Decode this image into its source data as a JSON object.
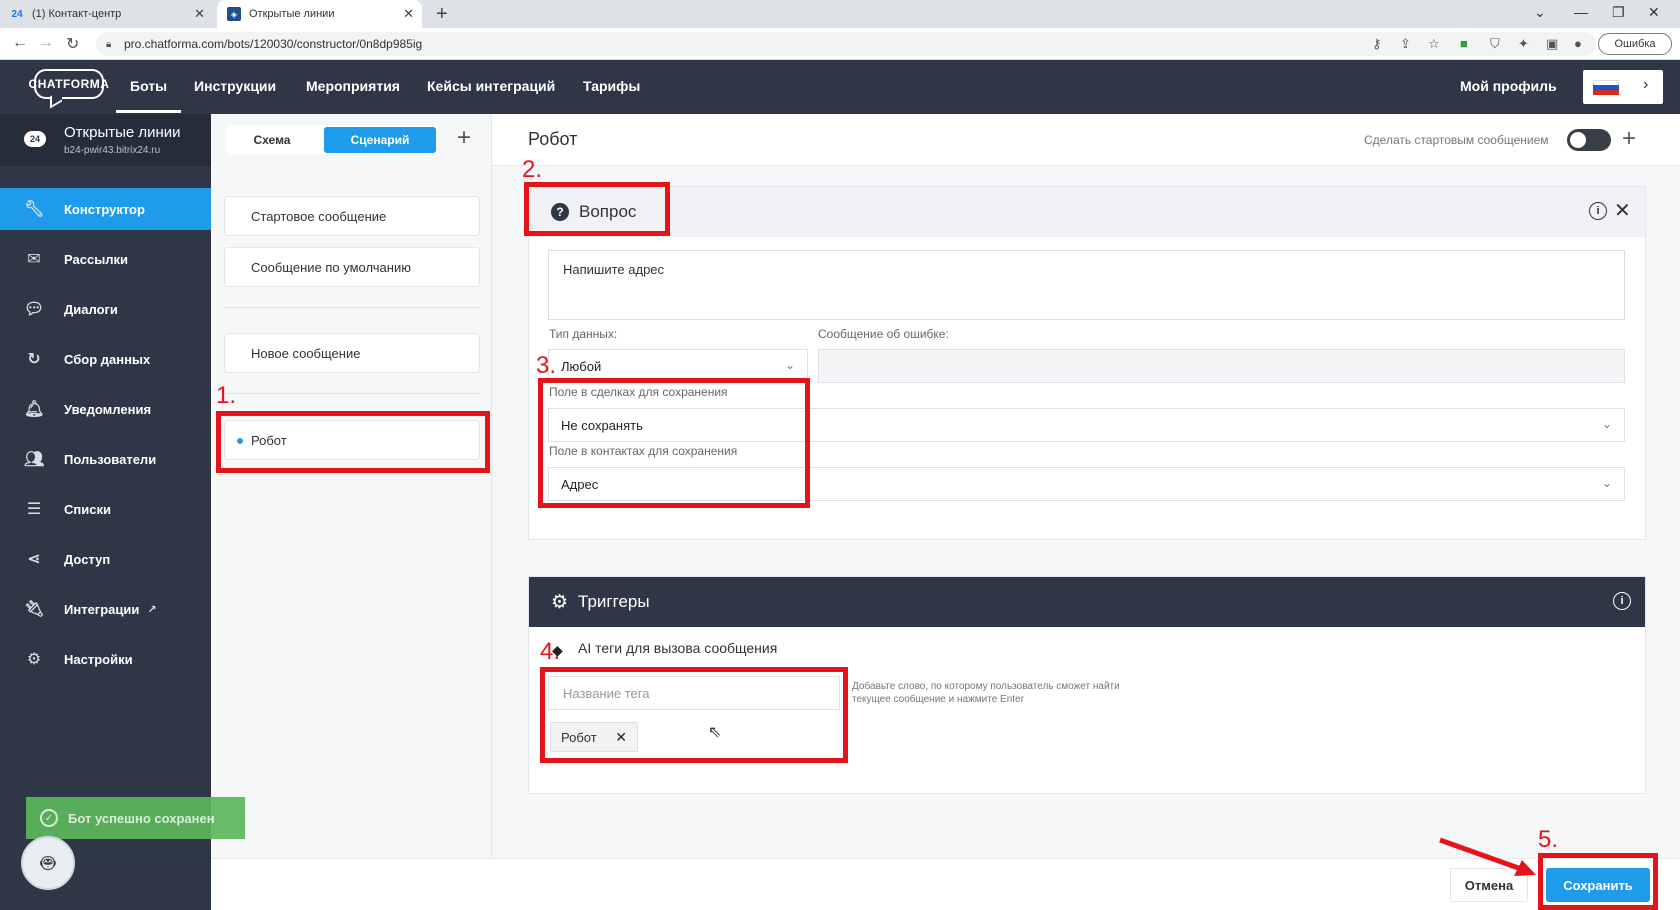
{
  "browser": {
    "tabs": [
      {
        "icon": "24",
        "label": "(1) Контакт-центр"
      },
      {
        "icon": "",
        "label": "Открытые линии"
      }
    ],
    "url": "pro.chatforma.com/bots/120030/constructor/0n8dp985ig",
    "profile_error": "Ошибка"
  },
  "header": {
    "logo": "CHATFORMA",
    "nav": [
      "Боты",
      "Инструкции",
      "Мероприятия",
      "Кейсы интеграций",
      "Тарифы"
    ],
    "profile": "Мой профиль",
    "colors": {
      "dark": "#2f3746",
      "accent": "#1e9bea"
    }
  },
  "sidebar": {
    "project_title": "Открытые линии",
    "project_sub": "b24-pwir43.bitrix24.ru",
    "items": [
      {
        "label": "Конструктор",
        "icon": "wrench-icon"
      },
      {
        "label": "Рассылки",
        "icon": "envelope-icon"
      },
      {
        "label": "Диалоги",
        "icon": "chat-icon"
      },
      {
        "label": "Сбор данных",
        "icon": "refresh-icon"
      },
      {
        "label": "Уведомления",
        "icon": "bell-icon"
      },
      {
        "label": "Пользователи",
        "icon": "users-icon"
      },
      {
        "label": "Списки",
        "icon": "list-icon"
      },
      {
        "label": "Доступ",
        "icon": "share-icon"
      },
      {
        "label": "Интеграции",
        "icon": "plug-icon"
      },
      {
        "label": "Настройки",
        "icon": "gear-icon"
      }
    ],
    "toast": "Бот успешно сохранен"
  },
  "middle": {
    "tab_schema": "Схема",
    "tab_scenario": "Сценарий",
    "messages": [
      "Стартовое сообщение",
      "Сообщение по умолчанию",
      "Новое сообщение",
      "Робот"
    ]
  },
  "main": {
    "title": "Робот",
    "start_label": "Сделать стартовым сообщением",
    "question": {
      "title": "Вопрос",
      "text": "Напишите адрес",
      "data_type_label": "Тип данных:",
      "data_type_value": "Любой",
      "error_label": "Сообщение об ошибке:",
      "deal_field_label": "Поле в сделках для сохранения",
      "deal_field_value": "Не сохранять",
      "contact_field_label": "Поле в контактах для сохранения",
      "contact_field_value": "Адрес"
    },
    "triggers": {
      "title": "Триггеры",
      "ai_tags_title": "AI теги для вызова сообщения",
      "tag_placeholder": "Название тега",
      "tag_hint": "Добавьте слово, по которому пользователь сможет найти текущее сообщение и нажмите Enter",
      "tags": [
        "Робот"
      ]
    },
    "cancel": "Отмена",
    "save": "Сохранить"
  },
  "annotations": [
    "1.",
    "2.",
    "3.",
    "4.",
    "5."
  ]
}
